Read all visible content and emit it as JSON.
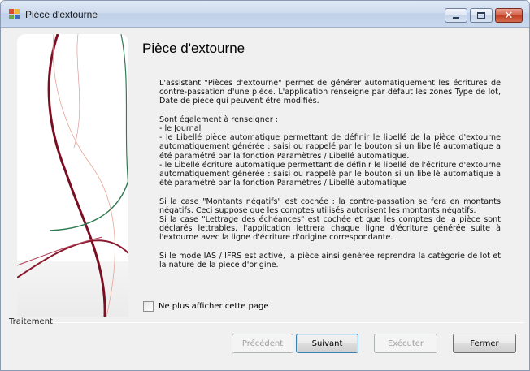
{
  "window": {
    "title": "Pièce d'extourne",
    "controls": {
      "minimize": "minimize-icon",
      "maximize": "maximize-icon",
      "close": "close-icon"
    },
    "accent_color": "#c13d22"
  },
  "main": {
    "heading": "Pièce d'extourne",
    "paragraphs": [
      "L'assistant \"Pièces d'extourne\" permet de générer automatiquement les écritures de contre-passation d'une pièce. L'application renseigne par défaut les zones Type de lot, Date de pièce qui peuvent être modifiés.",
      "Sont également à renseigner :",
      "- le Journal",
      "- le Libellé pièce automatique permettant de définir le libellé de la pièce d'extourne automatiquement générée : saisi ou rappelé par le bouton si un libellé automatique a été paramétré par la fonction Paramètres / Libellé automatique.",
      "- le Libellé écriture automatique permettant de définir le libellé de l'écriture d'extourne automatiquement générée : saisi ou rappelé par le bouton si un libellé automatique a été paramétré par la fonction Paramètres / Libellé automatique",
      "Si la case \"Montants négatifs\" est cochée : la contre-passation se fera en montants négatifs. Ceci suppose que les comptes utilisés autorisent les montants négatifs.",
      "Si la case \"Lettrage des échéances\" est cochée et que les comptes de la pièce sont déclarés lettrables, l'application lettrera chaque ligne d'écriture générée suite à l'extourne avec la ligne d'écriture d'origine correspondante.",
      "Si le mode IAS / IFRS est activé, la pièce ainsi générée reprendra la catégorie de lot et la nature de la pièce d'origine."
    ],
    "checkbox_label": "Ne plus afficher cette page",
    "checkbox_checked": false
  },
  "footer": {
    "group_label": "Traitement",
    "buttons": {
      "previous": "Précédent",
      "next": "Suivant",
      "execute": "Exécuter",
      "close": "Fermer"
    }
  }
}
